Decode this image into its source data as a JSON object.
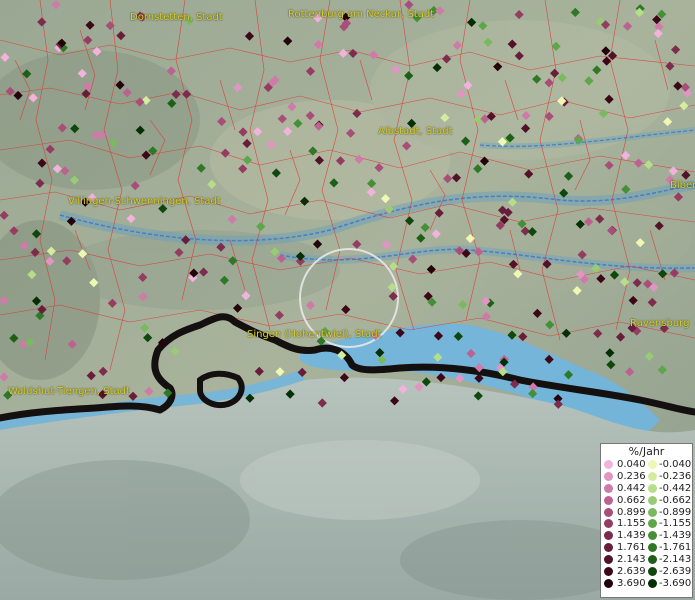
{
  "map": {
    "city_labels": [
      {
        "name": "Dornstetten, Stadt"
      },
      {
        "name": "Rottenburg am Neckar, Stadt"
      },
      {
        "name": "Albstadt, Stadt"
      },
      {
        "name": "Biber"
      },
      {
        "name": "Villingen-Schwenningen, Stadt"
      },
      {
        "name": "Singen (Hohentwiel), Stadt"
      },
      {
        "name": "Ravensburg"
      },
      {
        "name": "Waldshut-Tiengen, Stadt"
      }
    ],
    "legend": {
      "title": "%/Jahr",
      "positive": [
        {
          "label": "0.040",
          "color": "#f2b2dc"
        },
        {
          "label": "0.236",
          "color": "#e294c2"
        },
        {
          "label": "0.442",
          "color": "#cf7aa8"
        },
        {
          "label": "0.662",
          "color": "#bc6290"
        },
        {
          "label": "0.899",
          "color": "#a84e78"
        },
        {
          "label": "1.155",
          "color": "#943c62"
        },
        {
          "label": "1.439",
          "color": "#7e2c4e"
        },
        {
          "label": "1.761",
          "color": "#681e3a"
        },
        {
          "label": "2.143",
          "color": "#521228"
        },
        {
          "label": "2.639",
          "color": "#3c0818"
        },
        {
          "label": "3.690",
          "color": "#24020a"
        }
      ],
      "negative": [
        {
          "label": "-0.040",
          "color": "#eef7b4"
        },
        {
          "label": "-0.236",
          "color": "#d4eca0"
        },
        {
          "label": "-0.442",
          "color": "#b6de8a"
        },
        {
          "label": "-0.662",
          "color": "#98cc74"
        },
        {
          "label": "-0.899",
          "color": "#7aba5e"
        },
        {
          "label": "-1.155",
          "color": "#5ea64a"
        },
        {
          "label": "-1.439",
          "color": "#449036"
        },
        {
          "label": "-1.761",
          "color": "#2e7826"
        },
        {
          "label": "-2.143",
          "color": "#1c6018"
        },
        {
          "label": "-2.639",
          "color": "#0e480c"
        },
        {
          "label": "-3.690",
          "color": "#042e04"
        }
      ]
    }
  }
}
